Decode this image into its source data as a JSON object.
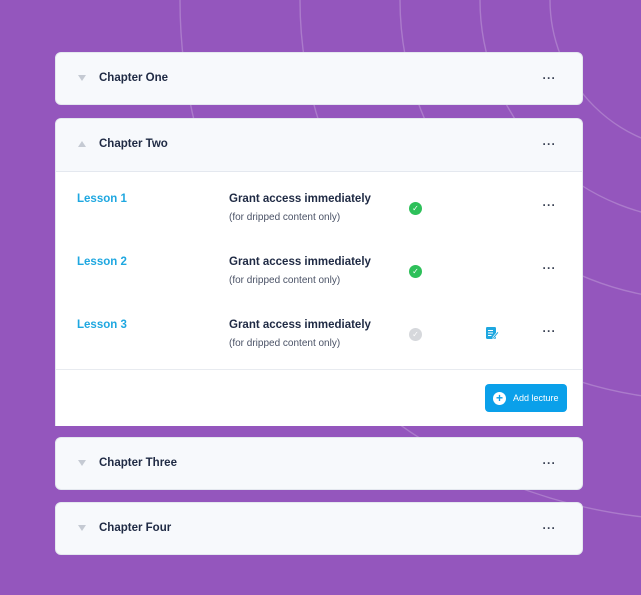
{
  "chapters": [
    {
      "title": "Chapter One",
      "expanded": false
    },
    {
      "title": "Chapter Two",
      "expanded": true
    },
    {
      "title": "Chapter Three",
      "expanded": false
    },
    {
      "title": "Chapter Four",
      "expanded": false
    }
  ],
  "more_label": "···",
  "lessons": [
    {
      "name": "Lesson 1",
      "access": "Grant access immediately",
      "note": "(for dripped content only)",
      "status": "published",
      "status_glyph": "✓",
      "has_edit_icon": false
    },
    {
      "name": "Lesson 2",
      "access": "Grant access immediately",
      "note": "(for dripped content only)",
      "status": "published",
      "status_glyph": "✓",
      "has_edit_icon": false
    },
    {
      "name": "Lesson 3",
      "access": "Grant access immediately",
      "note": "(for dripped content only)",
      "status": "draft",
      "status_glyph": "✓",
      "has_edit_icon": true
    }
  ],
  "add_lecture": {
    "label": "Add lecture",
    "icon": "plus-circle-icon"
  },
  "icons": {
    "chevron_down": "chevron-down-icon",
    "chevron_up": "chevron-up-icon",
    "more": "more-horizontal-icon",
    "edit": "edit-document-icon",
    "check": "check-circle-icon"
  },
  "colors": {
    "background": "#9456bd",
    "link": "#1ea7e0",
    "button": "#0aa0ea",
    "success": "#2ec05a",
    "inactive": "#d6d8dc"
  }
}
